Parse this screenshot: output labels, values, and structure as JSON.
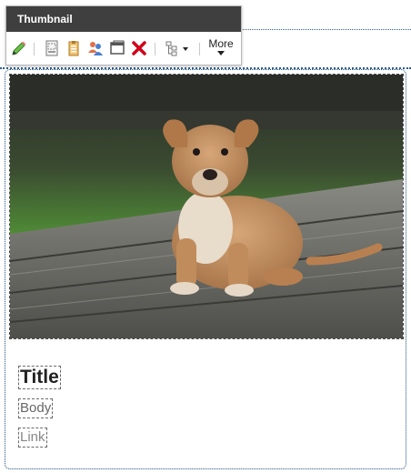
{
  "toolbar": {
    "title": "Thumbnail",
    "more_label": "More",
    "icons": [
      "pencil-icon",
      "template-icon",
      "clipboard-icon",
      "users-icon",
      "window-icon",
      "delete-icon",
      "tree-icon"
    ]
  },
  "card": {
    "image_alt": "Puppy sitting on wooden boards",
    "title": "Title",
    "body": "Body",
    "link": "Link"
  },
  "colors": {
    "toolbar_header": "#3f3f3f",
    "guide": "#2f5f8f",
    "delete": "#d0021b"
  }
}
